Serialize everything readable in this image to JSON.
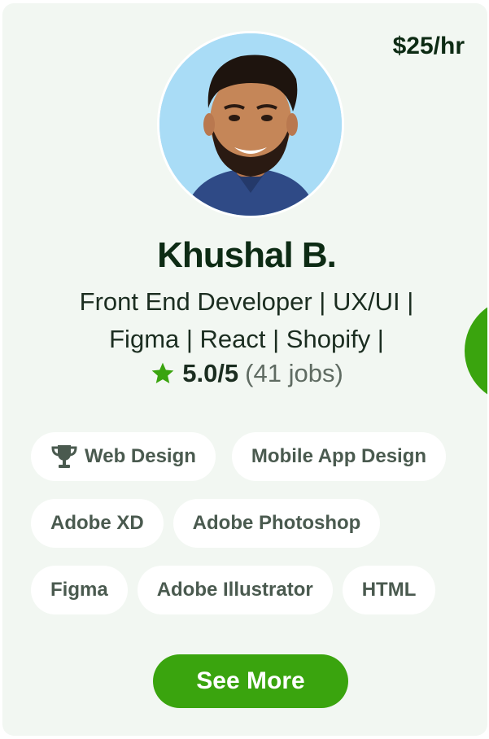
{
  "profile": {
    "rate": "$25/hr",
    "name": "Khushal B.",
    "headline_line1": "Front End Developer | UX/UI |",
    "headline_line2": "Figma | React | Shopify |",
    "rating_score": "5.0/5",
    "rating_jobs": "(41 jobs)",
    "avatar_icon": "avatar-photo"
  },
  "skills": {
    "row1": [
      "Web Design",
      "Mobile App Design"
    ],
    "row2": [
      "Adobe XD",
      "Adobe Photoshop"
    ],
    "row3": [
      "Figma",
      "Adobe Illustrator",
      "HTML"
    ]
  },
  "actions": {
    "see_more_label": "See More"
  },
  "colors": {
    "accent": "#3aa40e",
    "card_bg": "#f2f7f2",
    "text_dark": "#0d2b14"
  }
}
